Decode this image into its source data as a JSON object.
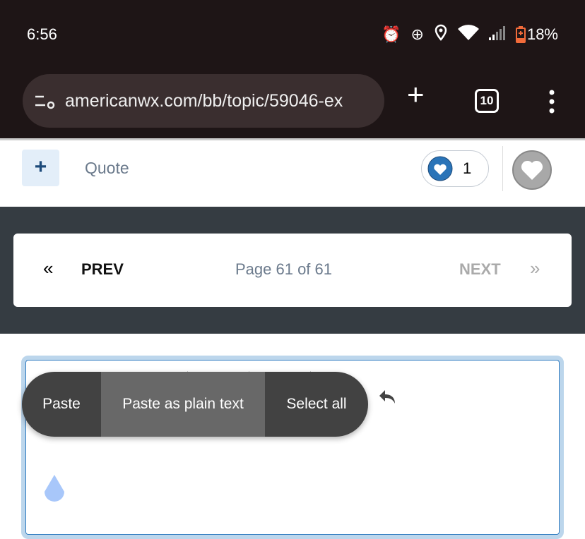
{
  "status_bar": {
    "time": "6:56",
    "battery": "18%",
    "icons": [
      "alarm-icon",
      "data-saver-icon",
      "location-icon",
      "wifi-icon",
      "signal-icon",
      "battery-icon"
    ]
  },
  "browser": {
    "url": "americanwx.com/bb/topic/59046-ex",
    "tab_count": "10"
  },
  "post_actions": {
    "add_label": "+",
    "quote_label": "Quote",
    "like_count": "1"
  },
  "pagination": {
    "prev_label": "PREV",
    "page_info": "Page 61 of 61",
    "next_label": "NEXT",
    "prev_icon": "«",
    "next_icon": "»"
  },
  "context_menu": {
    "items": [
      "Paste",
      "Paste as plain text",
      "Select all"
    ]
  },
  "colors": {
    "accent": "#2f7bc0",
    "status_bg": "#1e1516",
    "band": "#353c42"
  }
}
